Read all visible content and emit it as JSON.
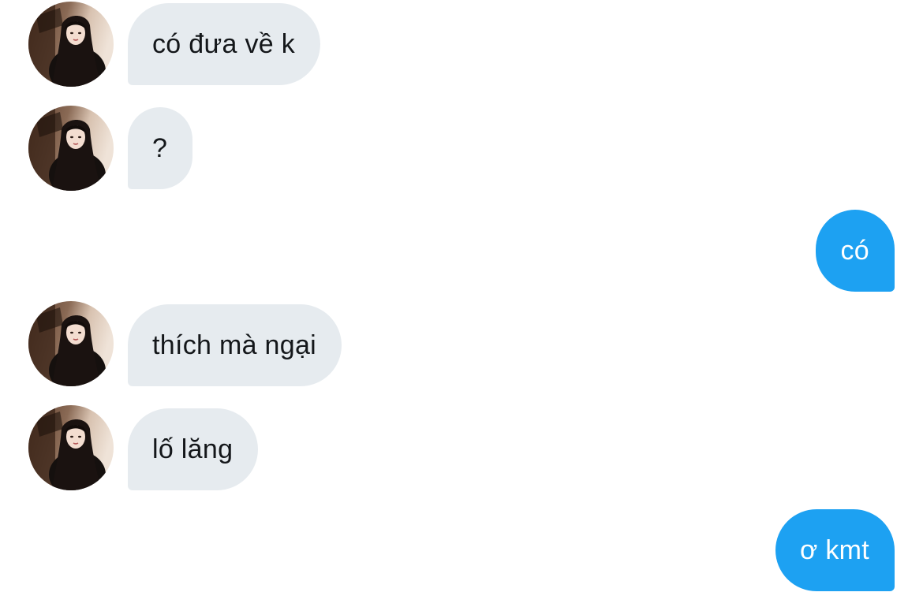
{
  "conversation": {
    "messages": [
      {
        "direction": "incoming",
        "text": "có đưa về k",
        "avatar_icon": "contact-avatar"
      },
      {
        "direction": "incoming",
        "text": "?",
        "avatar_icon": "contact-avatar"
      },
      {
        "direction": "outgoing",
        "text": "có"
      },
      {
        "direction": "incoming",
        "text": "thích mà ngại",
        "avatar_icon": "contact-avatar"
      },
      {
        "direction": "incoming",
        "text": "lố lăng",
        "avatar_icon": "contact-avatar"
      },
      {
        "direction": "outgoing",
        "text": "ơ kmt"
      }
    ]
  },
  "colors": {
    "incoming_bubble": "#e6ebef",
    "incoming_text": "#14171a",
    "outgoing_bubble": "#1da1f2",
    "outgoing_text": "#ffffff"
  }
}
